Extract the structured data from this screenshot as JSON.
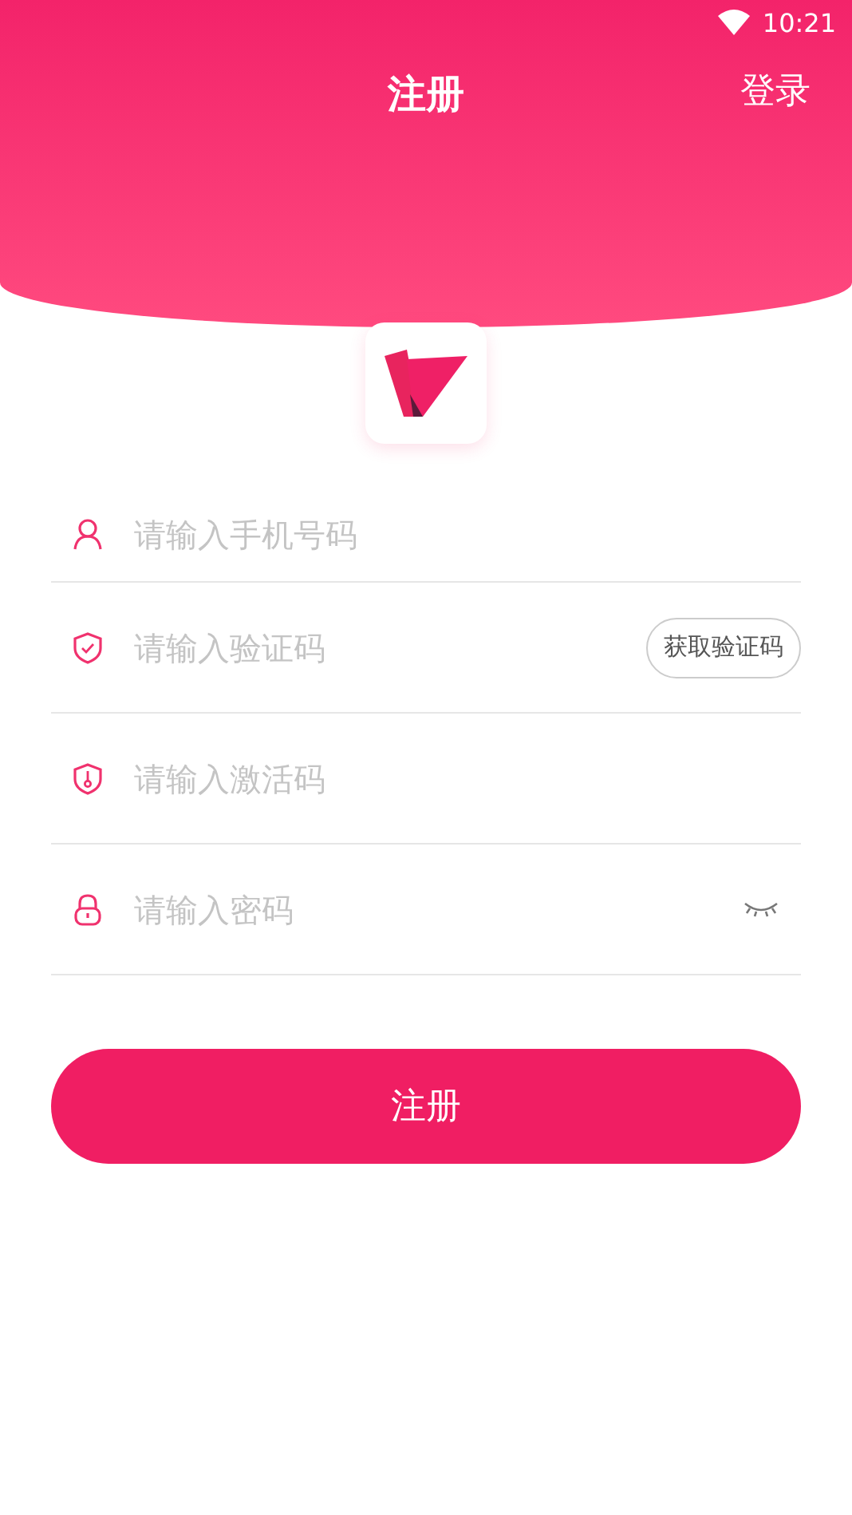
{
  "status_bar": {
    "time": "10:21"
  },
  "header": {
    "title": "注册",
    "login": "登录"
  },
  "fields": [
    {
      "kind": "phone",
      "placeholder": "请输入手机号码"
    },
    {
      "kind": "code",
      "placeholder": "请输入验证码",
      "button": "获取验证码"
    },
    {
      "kind": "activation",
      "placeholder": "请输入激活码"
    },
    {
      "kind": "password",
      "placeholder": "请输入密码"
    }
  ],
  "submit": "注册"
}
